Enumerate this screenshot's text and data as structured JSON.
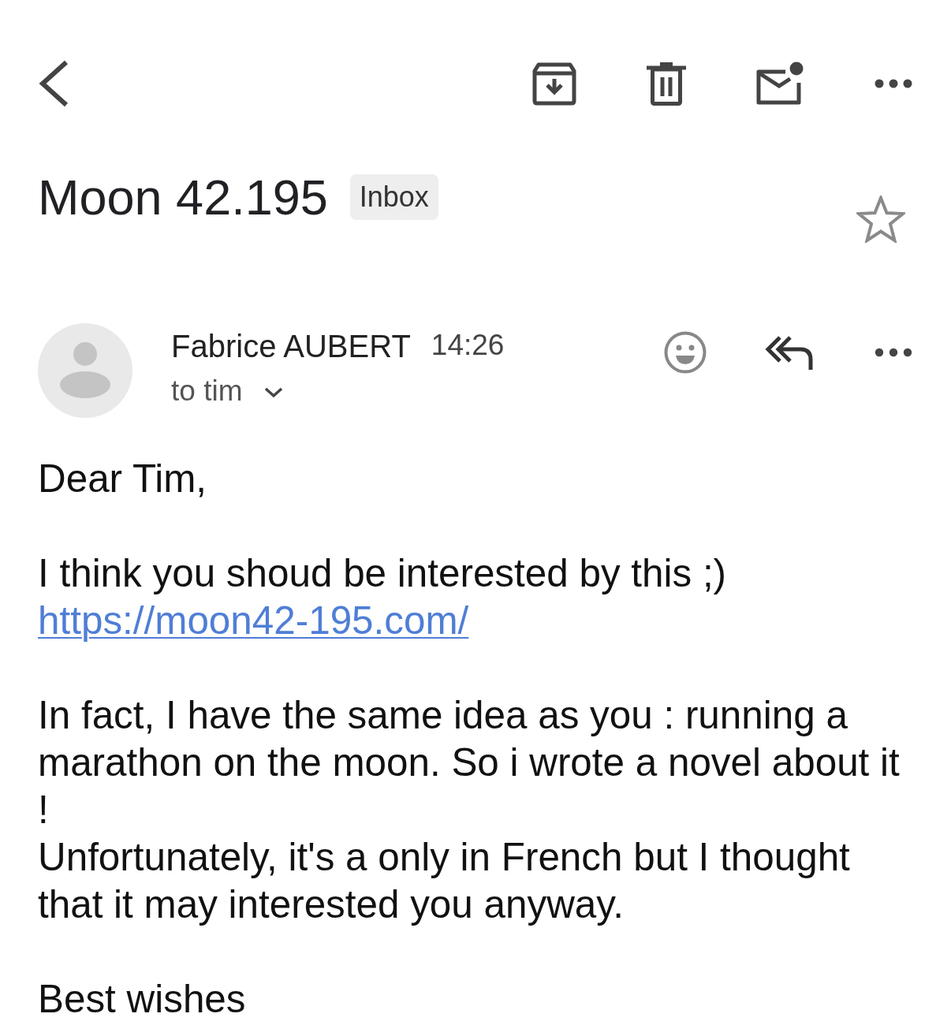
{
  "subject": {
    "title": "Moon 42.195",
    "labels": [
      "Inbox"
    ],
    "starred": false
  },
  "message": {
    "sender": "Fabrice AUBERT",
    "time": "14:26",
    "recipients": "to tim",
    "paragraphs": [
      {
        "lines": [
          {
            "kind": "text",
            "text": "Dear Tim,"
          }
        ]
      },
      {
        "lines": [
          {
            "kind": "text",
            "text": "I think you shoud be interested by this ;)"
          },
          {
            "kind": "link",
            "text": "https://moon42-195.com/"
          }
        ]
      },
      {
        "lines": [
          {
            "kind": "text",
            "text": "In fact, I have the same idea as you : running a marathon on the moon. So i wrote a novel about it !"
          },
          {
            "kind": "text",
            "text": "Unfortunately, it's a only in French but I thought that it may interested you anyway."
          }
        ]
      },
      {
        "lines": [
          {
            "kind": "text",
            "text": "Best wishes"
          }
        ]
      }
    ]
  }
}
